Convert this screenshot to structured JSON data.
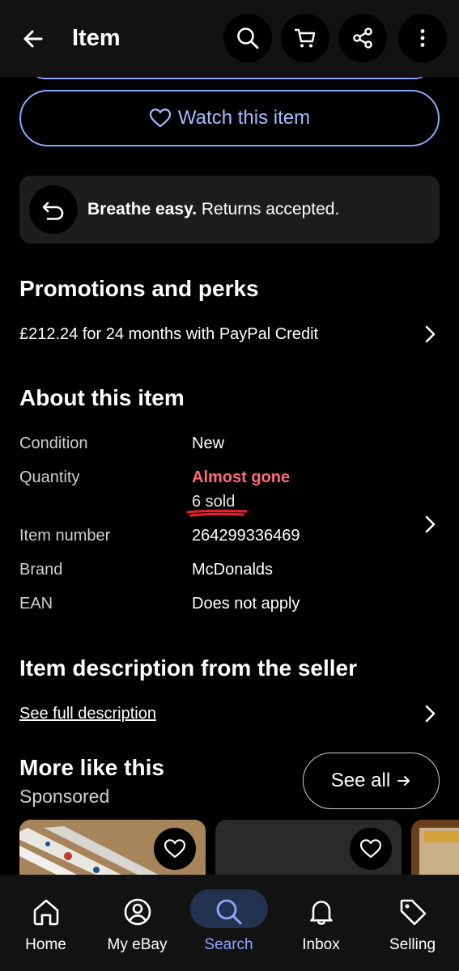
{
  "header": {
    "title": "Item"
  },
  "watch": {
    "label": "Watch this item"
  },
  "returns": {
    "bold": "Breathe easy.",
    "text": " Returns accepted."
  },
  "promotions": {
    "title": "Promotions and perks",
    "credit_text": "£212.24 for 24 months with PayPal Credit"
  },
  "about": {
    "title": "About this item",
    "rows": [
      {
        "label": "Condition",
        "value": "New"
      },
      {
        "label": "Quantity",
        "value": "Almost gone",
        "sub": "6 sold"
      },
      {
        "label": "Item number",
        "value": "264299336469"
      },
      {
        "label": "Brand",
        "value": "McDonalds"
      },
      {
        "label": "EAN",
        "value": "Does not apply"
      }
    ]
  },
  "description": {
    "title": "Item description from the seller",
    "link": "See full description"
  },
  "more": {
    "title": "More like this",
    "sponsored": "Sponsored",
    "see_all": "See all"
  },
  "bottom_nav": {
    "items": [
      {
        "label": "Home",
        "icon": "home-icon"
      },
      {
        "label": "My eBay",
        "icon": "profile-icon"
      },
      {
        "label": "Search",
        "icon": "search-icon",
        "active": true
      },
      {
        "label": "Inbox",
        "icon": "bell-icon"
      },
      {
        "label": "Selling",
        "icon": "tag-icon"
      }
    ]
  },
  "colors": {
    "accent": "#8fa6ff",
    "almost_gone": "#ff6b79",
    "annotation": "#e0202a"
  }
}
